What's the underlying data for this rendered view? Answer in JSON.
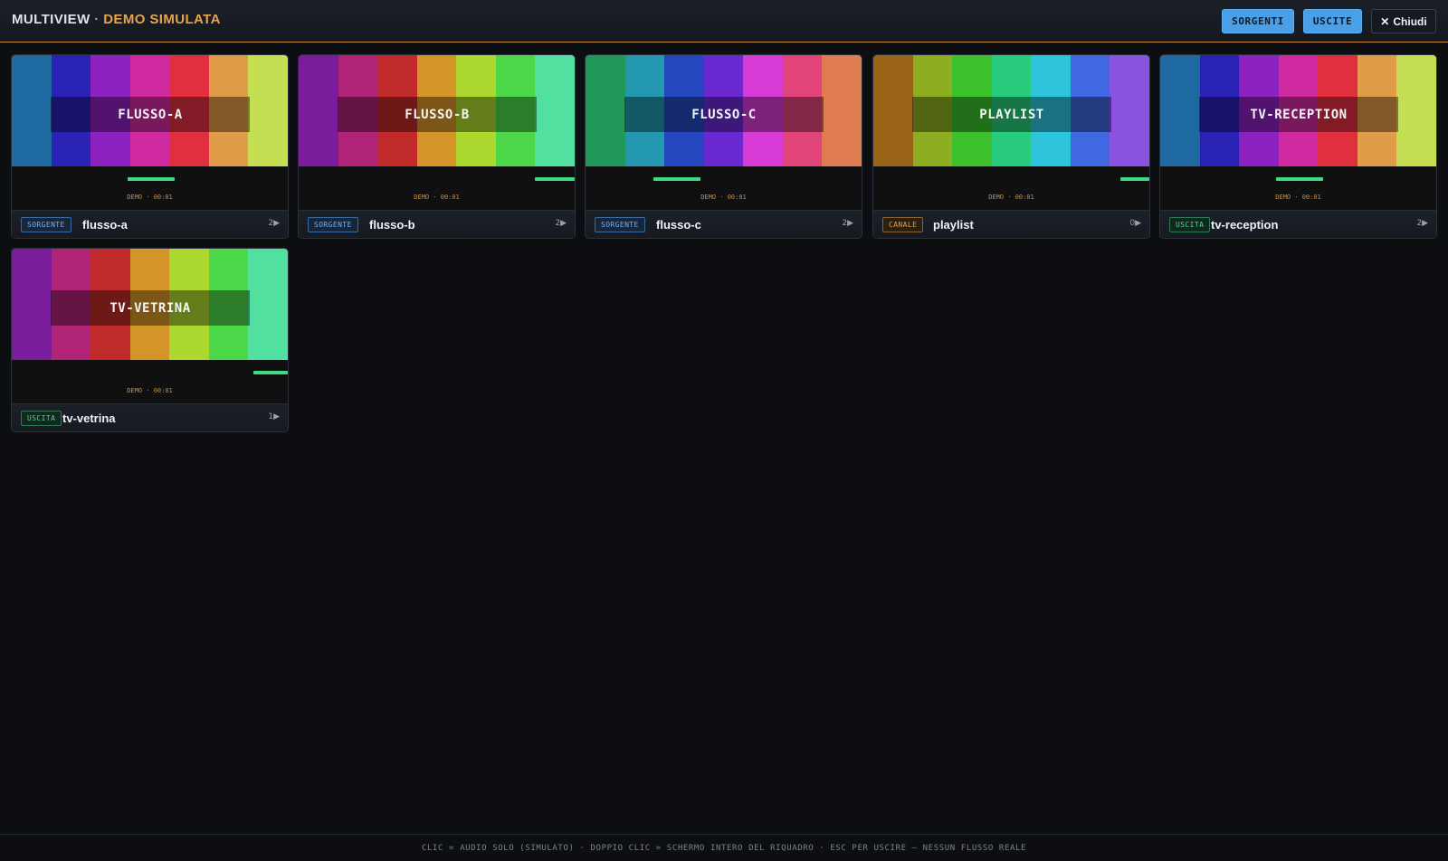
{
  "header": {
    "title_main": "MULTIVIEW",
    "title_sep": " · ",
    "title_sub": "DEMO SIMULATA",
    "btn_sources": "SORGENTI",
    "btn_outputs": "USCITE",
    "btn_close_icon": "✕",
    "btn_close": "Chiudi"
  },
  "colors": {
    "accent": "#e6a54d",
    "primary_button": "#4aa0e6",
    "meter": "#3ddc84"
  },
  "tiles": [
    {
      "overlay": "FLUSSO-A",
      "badge": "SORGENTE",
      "badge_kind": "src",
      "name": "flusso-a",
      "count": "2▶",
      "demo": "DEMO · 00:01",
      "meter_level": 0.5,
      "bars": [
        "#1e6aa0",
        "#2a22b4",
        "#8e22c0",
        "#d02aa0",
        "#e03040",
        "#e09c48",
        "#c4e052"
      ]
    },
    {
      "overlay": "FLUSSO-B",
      "badge": "SORGENTE",
      "badge_kind": "src",
      "name": "flusso-b",
      "count": "2▶",
      "demo": "DEMO · 00:01",
      "meter_level": 0.94,
      "bars": [
        "#7a1c9c",
        "#b02478",
        "#c02a2a",
        "#d49428",
        "#acd830",
        "#4cd848",
        "#52e0a0"
      ]
    },
    {
      "overlay": "FLUSSO-C",
      "badge": "SORGENTE",
      "badge_kind": "src",
      "name": "flusso-c",
      "count": "2▶",
      "demo": "DEMO · 00:01",
      "meter_level": 0.33,
      "bars": [
        "#20985a",
        "#2398b0",
        "#2548c0",
        "#6a28d0",
        "#d83ad6",
        "#e04478",
        "#e07c52"
      ]
    },
    {
      "overlay": "PLAYLIST",
      "badge": "CANALE",
      "badge_kind": "ch",
      "name": "playlist",
      "count": "0▶",
      "demo": "DEMO · 00:01",
      "meter_level": 0.98,
      "bars": [
        "#9a6418",
        "#8eae22",
        "#3cc02c",
        "#28cc7c",
        "#2ec4dc",
        "#4068e0",
        "#8a54e0"
      ]
    },
    {
      "overlay": "TV-RECEPTION",
      "badge": "USCITA",
      "badge_kind": "out",
      "name": "tv-reception",
      "count": "2▶",
      "demo": "DEMO · 00:01",
      "meter_level": 0.5,
      "bars": [
        "#1e6aa0",
        "#2a22b4",
        "#8e22c0",
        "#d02aa0",
        "#e03040",
        "#e09c48",
        "#c4e052"
      ]
    },
    {
      "overlay": "TV-VETRINA",
      "badge": "USCITA",
      "badge_kind": "out",
      "name": "tv-vetrina",
      "count": "1▶",
      "demo": "DEMO · 00:01",
      "meter_level": 0.96,
      "bars": [
        "#7a1c9c",
        "#b02478",
        "#c02a2a",
        "#d49428",
        "#acd830",
        "#4cd848",
        "#52e0a0"
      ]
    }
  ],
  "footer": {
    "hint": "CLIC = AUDIO SOLO (SIMULATO) · DOPPIO CLIC = SCHERMO INTERO DEL RIQUADRO · ESC PER USCIRE — NESSUN FLUSSO REALE"
  }
}
